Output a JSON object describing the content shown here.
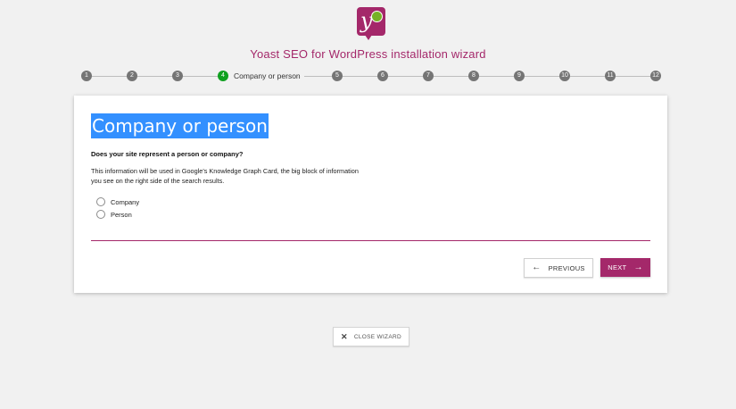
{
  "header": {
    "logo_letter": "y",
    "wizard_title": "Yoast SEO for WordPress installation wizard"
  },
  "stepper": {
    "steps": [
      "1",
      "2",
      "3",
      "4",
      "5",
      "6",
      "7",
      "8",
      "9",
      "10",
      "11",
      "12"
    ],
    "active_index": 3,
    "active_label": "Company or person"
  },
  "card": {
    "heading": "Company or person",
    "question": "Does your site represent a person or company?",
    "info": "This information will be used in Google's Knowledge Graph Card, the big block of information you see on the right side of the search results.",
    "options": [
      "Company",
      "Person"
    ],
    "previous_label": "PREVIOUS",
    "next_label": "NEXT"
  },
  "footer": {
    "close_label": "CLOSE WIZARD"
  },
  "colors": {
    "brand": "#a4286a",
    "active_step": "#10a020",
    "selection": "#3390ff"
  }
}
